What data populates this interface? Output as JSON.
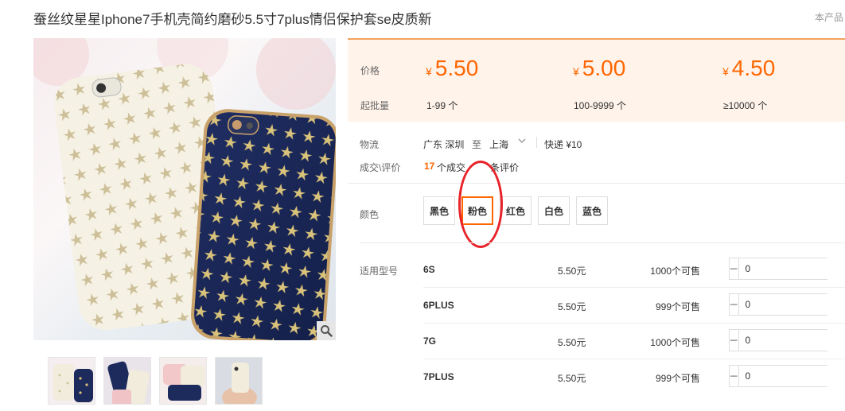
{
  "product": {
    "title": "蚕丝纹星星Iphone7手机壳简约磨砂5.5寸7plus情侣保护套se皮质新",
    "corner_text": "本产品"
  },
  "icons": {
    "zoom": "magnifier-icon",
    "minus": "minus-icon",
    "plus": "plus-icon",
    "dropdown": "chevron-down-icon"
  },
  "colors": {
    "price": "#ff6600",
    "price_bg": "#fff3ea",
    "selected_border": "#ff6600",
    "annotation": "#e8232a"
  },
  "pricing": {
    "price_label": "价格",
    "qty_label": "起批量",
    "currency": "¥",
    "tiers": [
      {
        "price": "5.50",
        "range": "1-99 个"
      },
      {
        "price": "5.00",
        "range": "100-9999 个"
      },
      {
        "price": "4.50",
        "range": "≥10000 个"
      }
    ]
  },
  "logistics": {
    "label": "物流",
    "origin": "广东 深圳",
    "to": "至",
    "destination": "上海",
    "shipping": "快递 ¥10"
  },
  "deals": {
    "label": "成交\\评价",
    "count": "17",
    "count_suffix": "个成交",
    "reviews": "1条评价",
    "reviews_visible": "条评价"
  },
  "color_options": {
    "label": "颜色",
    "options": [
      "黑色",
      "粉色",
      "红色",
      "白色",
      "蓝色"
    ],
    "selected": "粉色"
  },
  "variants": {
    "label": "适用型号",
    "rows": [
      {
        "name": "6S",
        "price": "5.50元",
        "stock": "1000个可售",
        "qty": "0"
      },
      {
        "name": "6PLUS",
        "price": "5.50元",
        "stock": "999个可售",
        "qty": "0"
      },
      {
        "name": "7G",
        "price": "5.50元",
        "stock": "1000个可售",
        "qty": "0"
      },
      {
        "name": "7PLUS",
        "price": "5.50元",
        "stock": "999个可售",
        "qty": "0"
      }
    ]
  }
}
